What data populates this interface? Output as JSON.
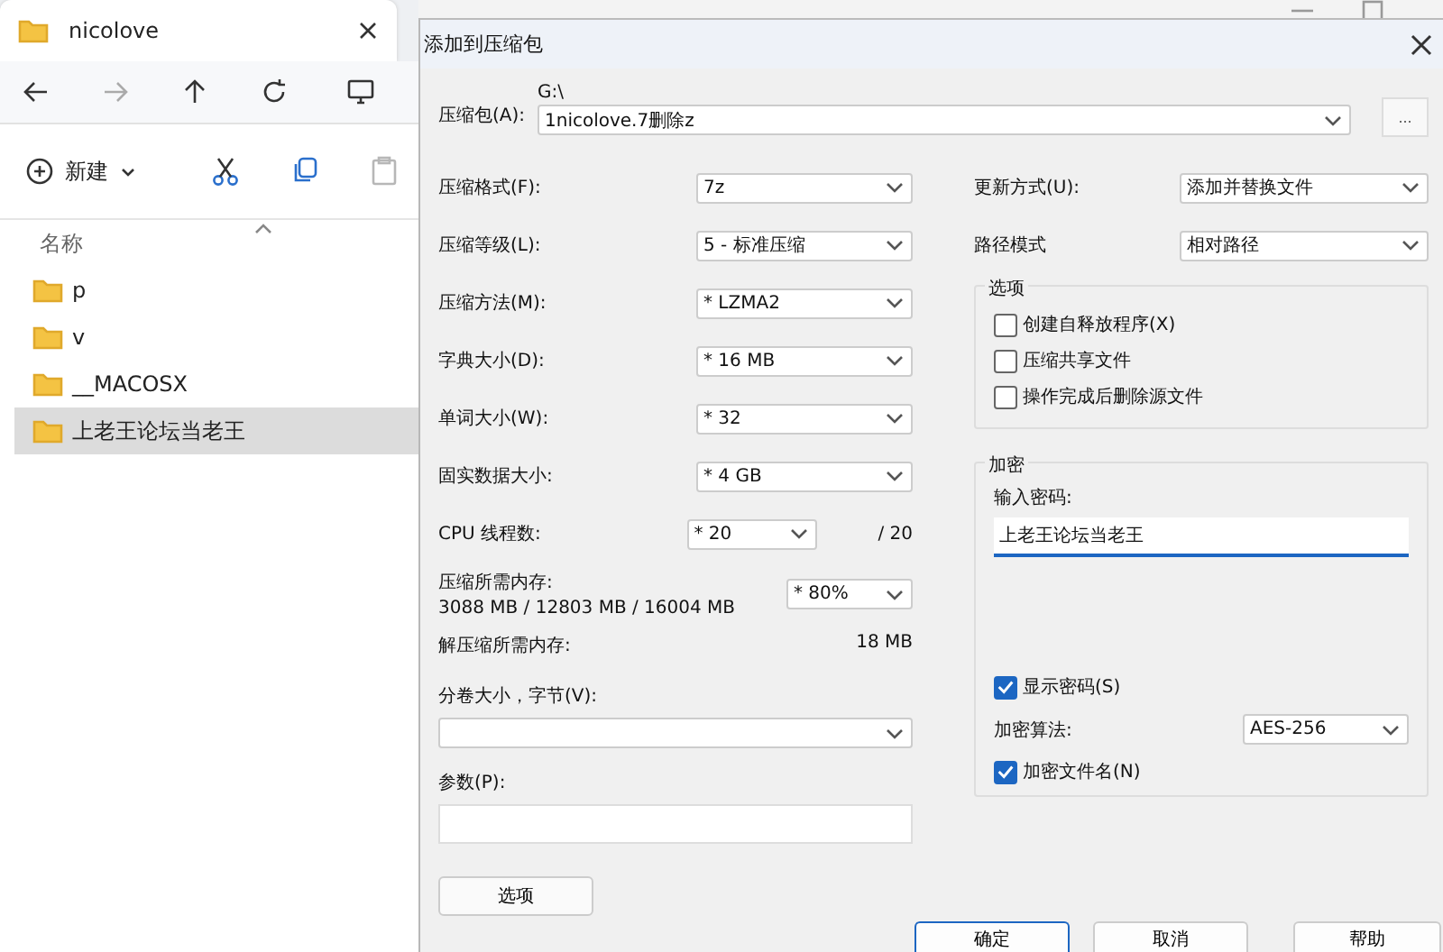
{
  "explorer": {
    "tab": {
      "title": "nicolove",
      "selected": true
    },
    "toolbar": {
      "new_label": "新建",
      "paste_disabled": true
    },
    "column_header": "名称",
    "files": [
      {
        "name": "p",
        "selected": false
      },
      {
        "name": "v",
        "selected": false
      },
      {
        "name": "__MACOSX",
        "selected": false
      },
      {
        "name": "上老王论坛当老王",
        "selected": true
      }
    ]
  },
  "dialog": {
    "title": "添加到压缩包",
    "archive": {
      "label": "压缩包(A):",
      "path": "G:\\",
      "value": "1nicolove.7删除z",
      "browse": "..."
    },
    "left_rows": [
      {
        "label": "压缩格式(F):",
        "value": "7z"
      },
      {
        "label": "压缩等级(L):",
        "value": "5 - 标准压缩"
      },
      {
        "label": "压缩方法(M):",
        "value": "*  LZMA2"
      },
      {
        "label": "字典大小(D):",
        "value": "*  16 MB"
      },
      {
        "label": "单词大小(W):",
        "value": "*  32"
      },
      {
        "label": "固实数据大小:",
        "value": "*  4 GB"
      }
    ],
    "cpu": {
      "label": "CPU 线程数:",
      "value": "*  20",
      "total": "/ 20"
    },
    "memory": {
      "label": "压缩所需内存:",
      "detail": "3088 MB / 12803 MB / 16004 MB",
      "value": "* 80%"
    },
    "decompress": {
      "label": "解压缩所需内存:",
      "value": "18 MB"
    },
    "volume": {
      "label": "分卷大小，字节(V):"
    },
    "params": {
      "label": "参数(P):"
    },
    "options_button": "选项",
    "right_rows": [
      {
        "label": "更新方式(U):",
        "value": "添加并替换文件"
      },
      {
        "label": "路径模式",
        "value": "相对路径"
      }
    ],
    "options_group": {
      "title": "选项",
      "items": [
        {
          "label": "创建自释放程序(X)",
          "checked": false
        },
        {
          "label": "压缩共享文件",
          "checked": false
        },
        {
          "label": "操作完成后删除源文件",
          "checked": false
        }
      ]
    },
    "encryption": {
      "title": "加密",
      "password_label": "输入密码:",
      "password": "上老王论坛当老王",
      "show_password": {
        "label": "显示密码(S)",
        "checked": true
      },
      "method_label": "加密算法:",
      "method": "AES-256",
      "encrypt_names": {
        "label": "加密文件名(N)",
        "checked": true
      }
    },
    "buttons": [
      "确定",
      "取消",
      "帮助"
    ]
  }
}
